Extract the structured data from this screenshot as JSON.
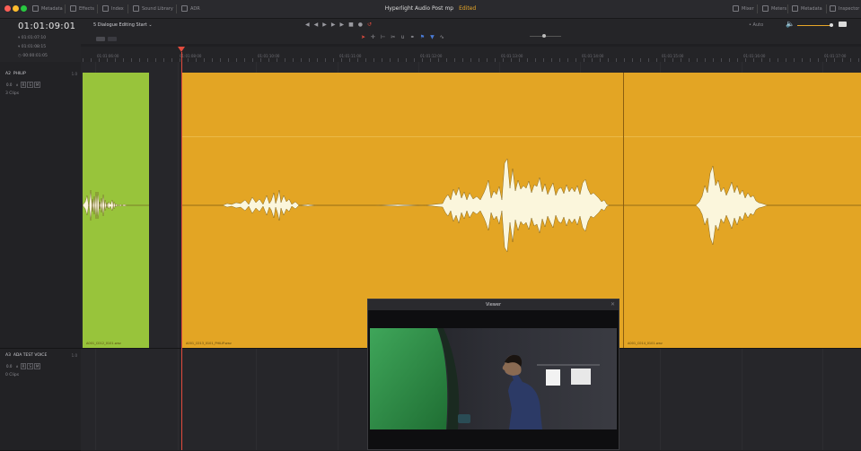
{
  "window": {
    "title": "Hyperlight Audio Post mp",
    "status": "Edited",
    "traffic_light_colors": [
      "#fc5f57",
      "#fdbc2e",
      "#28c840"
    ]
  },
  "topbar": {
    "left_buttons": [
      "Metadata",
      "Effects",
      "Index",
      "Sound Library",
      "ADR"
    ],
    "right_buttons": [
      "Mixer",
      "Meters",
      "Metadata",
      "Inspector"
    ]
  },
  "timecode": {
    "main": "01:01:09:01",
    "in": "01:01:07:10",
    "out": "01:01:08:15",
    "duration": "00:00:01:05"
  },
  "toolbar": {
    "timeline_select": "5 Dialogue Editing Start",
    "zoom_label": "Auto"
  },
  "ruler": {
    "ticks": [
      "01:01:06:00",
      "01:01:08:00",
      "01:01:10:00",
      "01:01:11:00",
      "01:01:12:00",
      "01:01:13:00",
      "01:01:14:00",
      "01:01:15:00",
      "01:01:16:00",
      "01:01:17:00"
    ]
  },
  "tracks": [
    {
      "id": "A2",
      "name": "PHILIP",
      "channel": "1.0",
      "volume": "0.0",
      "buttons": [
        "R",
        "S",
        "M"
      ],
      "clips": "3 Clips"
    },
    {
      "id": "A3",
      "name": "ADA TEST VOICE",
      "channel": "1.0",
      "volume": "0.0",
      "buttons": [
        "R",
        "S",
        "M"
      ],
      "clips": "0 Clips"
    }
  ],
  "clips": [
    {
      "label": "A001_C012_0101.wav",
      "color": "#98c43b"
    },
    {
      "label": "A001_C013_0101_PHILIP.wav",
      "color": "#e3a524"
    },
    {
      "label": "A001_C014_0101.wav",
      "color": "#e3a524"
    }
  ],
  "viewer": {
    "title": "Viewer"
  },
  "colors": {
    "playhead": "#e24b3d",
    "clip_orange": "#e3a524",
    "clip_green": "#98c43b",
    "accent": "#e8a728"
  }
}
